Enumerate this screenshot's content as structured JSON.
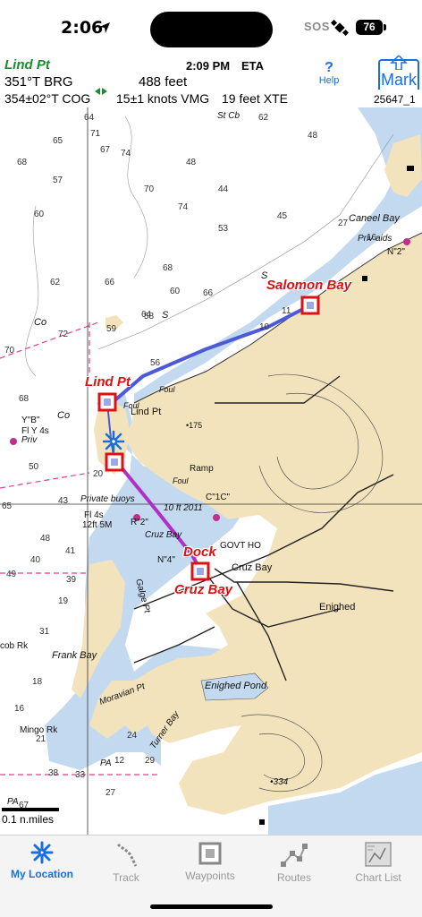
{
  "status": {
    "time": "2:06",
    "sos": "SOS",
    "battery": "76"
  },
  "header": {
    "destination": "Lind Pt",
    "clock": "2:09 PM",
    "eta_label": "ETA",
    "bearing": "351°T BRG",
    "distance": "488 feet",
    "cog": "354±02°T COG",
    "vmg": "15±1 knots VMG",
    "xte": "19 feet XTE",
    "chart_number": "25647_1",
    "help_label": "Help",
    "help_symbol": "?",
    "mark_label": "Mark"
  },
  "waypoints": [
    {
      "name": "Salomon Bay"
    },
    {
      "name": "Lind Pt"
    },
    {
      "name": "Dock"
    },
    {
      "name": "Cruz Bay"
    }
  ],
  "places": {
    "caneel": "Caneel Bay",
    "priv_aids": "Priv aids",
    "lind_pt": "Lind Pt",
    "cruz_bay": "Cruz Bay",
    "enighed": "Enighed",
    "enighed_pond": "Enighed Pond",
    "frank_bay": "Frank Bay",
    "gallows_pt": "Galge Pt",
    "moravian": "Moravian Pt",
    "turner": "Turner Bay",
    "private_buoys": "Private buoys",
    "fl4s": "Fl 4s",
    "fl4s_b": "12ft 5M",
    "ramp": "Ramp",
    "govt": "GOVT HO",
    "tenft": "10 ft 2011",
    "yb": "Y\"B\"",
    "flY": "Fl Y 4s",
    "priv": "Priv",
    "mingo": "Mingo Rk",
    "cob": "cob Rk",
    "st_cb": "St Cb",
    "foul": "Foul",
    "co": "Co",
    "s": "S",
    "pa": "PA",
    "n2": "N\"2\"",
    "c1c": "C\"1C\"",
    "r2": "R\"2\"",
    "n4": "N\"4\"",
    "contour_334": "•334",
    "contour_175": "•175"
  },
  "soundings": [
    "64",
    "62",
    "71",
    "65",
    "67",
    "68",
    "57",
    "60",
    "74",
    "48",
    "70",
    "44",
    "68",
    "74",
    "45",
    "48",
    "60",
    "66",
    "62",
    "53",
    "59",
    "72",
    "66",
    "58",
    "64",
    "70",
    "56",
    "68",
    "50",
    "20",
    "43",
    "65",
    "48",
    "49",
    "40",
    "39",
    "41",
    "19",
    "31",
    "18",
    "16",
    "21",
    "24",
    "33",
    "67",
    "38",
    "12",
    "29",
    "27",
    "16",
    "10",
    "11",
    "27"
  ],
  "scale": {
    "label": "0.1 n.miles"
  },
  "tabs": [
    {
      "label": "My Location",
      "active": true
    },
    {
      "label": "Track",
      "active": false
    },
    {
      "label": "Waypoints",
      "active": false
    },
    {
      "label": "Routes",
      "active": false
    },
    {
      "label": "Chart List",
      "active": false
    }
  ],
  "colors": {
    "land": "#f3e3bc",
    "shallow": "#c3d9ef",
    "accent": "#1a6fe0",
    "route": "#b02fc6",
    "waypoint": "#d11111",
    "dest": "#1d8a2e"
  }
}
